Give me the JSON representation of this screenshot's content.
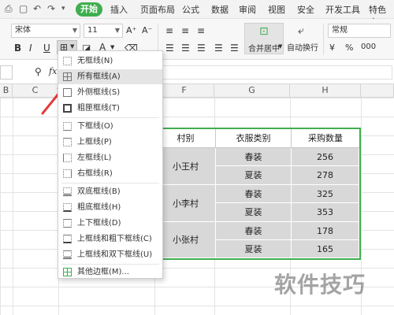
{
  "tabs": {
    "active": "开始",
    "items": [
      "插入",
      "页面布局",
      "公式",
      "数据",
      "审阅",
      "视图",
      "安全",
      "开发工具",
      "特色应"
    ]
  },
  "ribbon": {
    "font_name": "宋体",
    "font_size": "11",
    "merge_label": "合并居中",
    "wrap_label": "自动换行",
    "number_format": "常规",
    "bold": "B",
    "italic": "I",
    "underline": "U",
    "font_color_letter": "A",
    "percent": "%",
    "thousand": "000"
  },
  "formula_bar": {
    "fx": "fx"
  },
  "columns": [
    "B",
    "C",
    "F",
    "G",
    "H"
  ],
  "table": {
    "headers": [
      "村别",
      "衣服类别",
      "采购数量"
    ],
    "groups": [
      {
        "village": "小王村",
        "rows": [
          {
            "type": "春装",
            "qty": "256"
          },
          {
            "type": "夏装",
            "qty": "278"
          }
        ]
      },
      {
        "village": "小李村",
        "rows": [
          {
            "type": "春装",
            "qty": "325"
          },
          {
            "type": "夏装",
            "qty": "353"
          }
        ]
      },
      {
        "village": "小张村",
        "rows": [
          {
            "type": "春装",
            "qty": "178"
          },
          {
            "type": "夏装",
            "qty": "165"
          }
        ]
      }
    ]
  },
  "border_menu": {
    "items": [
      "无框线(N)",
      "所有框线(A)",
      "外侧框线(S)",
      "粗匣框线(T)",
      "下框线(O)",
      "上框线(P)",
      "左框线(L)",
      "右框线(R)",
      "双底框线(B)",
      "粗底框线(H)",
      "上下框线(D)",
      "上框线和粗下框线(C)",
      "上框线和双下框线(U)",
      "其他边框(M)..."
    ],
    "highlighted_index": 1
  },
  "watermark": "软件技巧",
  "colors": {
    "accent_green": "#3fae4e",
    "arrow_red": "#e23b3b",
    "cell_gray": "#d8d8d8"
  }
}
